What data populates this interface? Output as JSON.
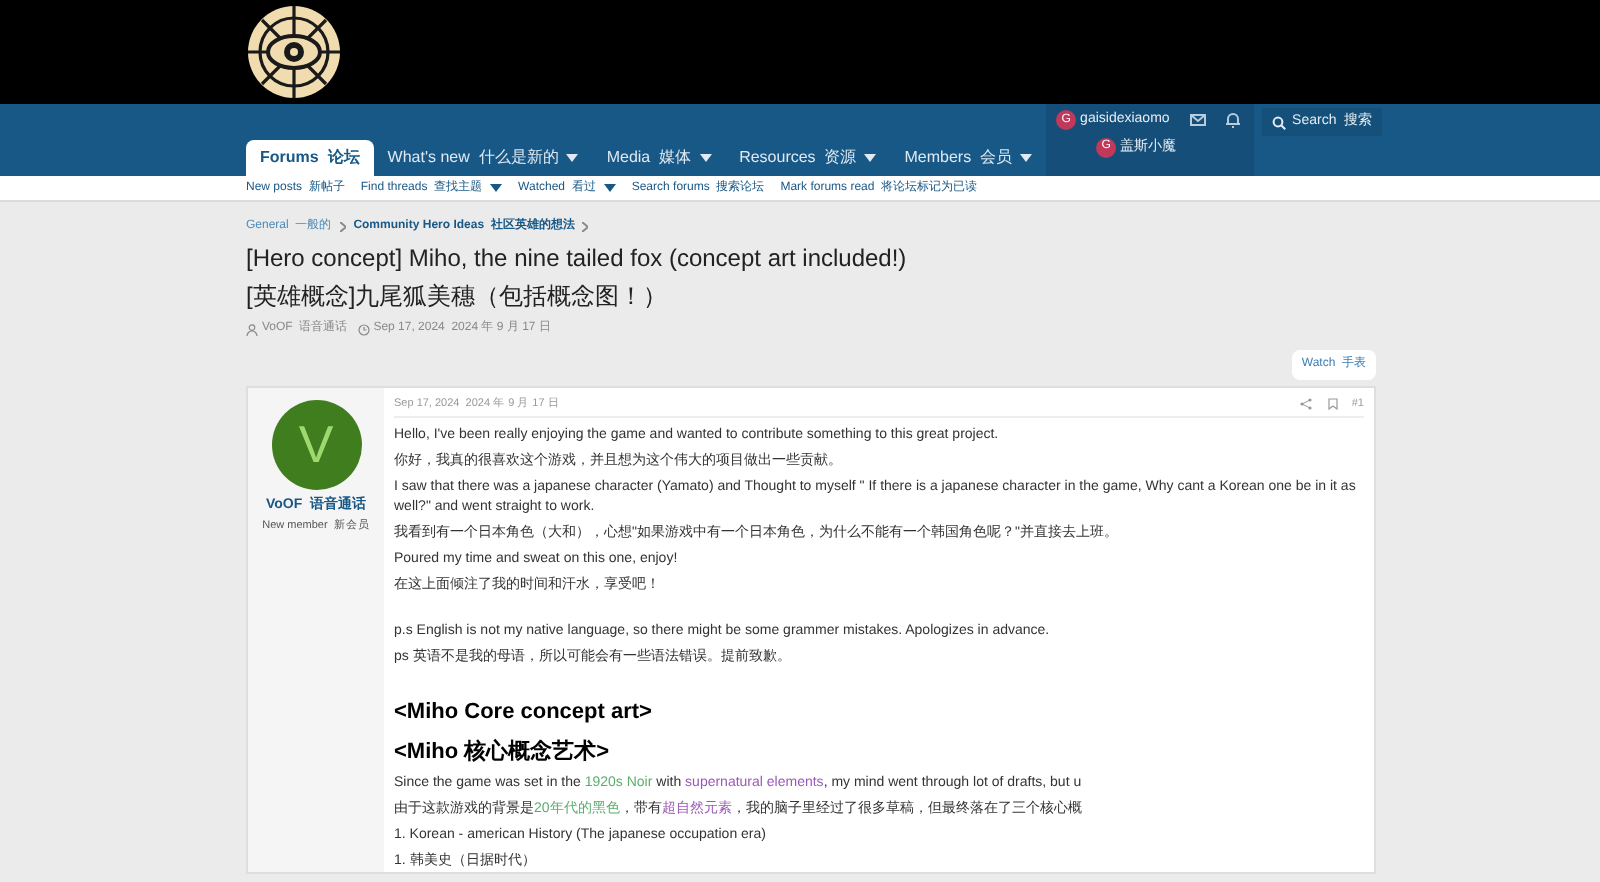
{
  "nav": {
    "tabs": [
      {
        "label": "Forums  论坛",
        "selected": true,
        "dropdown": false
      },
      {
        "label": "What's new  什么是新的",
        "selected": false,
        "dropdown": true
      },
      {
        "label": "Media  媒体",
        "selected": false,
        "dropdown": true
      },
      {
        "label": "Resources  资源",
        "selected": false,
        "dropdown": true
      },
      {
        "label": "Members  会员",
        "selected": false,
        "dropdown": true
      }
    ],
    "user": {
      "avatar_letter": "G",
      "name": "gaisidexiaomo",
      "alt_avatar_letter": "G",
      "alt_name": "盖斯小魔"
    },
    "search": "Search  搜索"
  },
  "subnav": [
    {
      "label": "New posts  新帖子",
      "dropdown": false
    },
    {
      "label": "Find threads  查找主题",
      "dropdown": true
    },
    {
      "label": "Watched  看过",
      "dropdown": true
    },
    {
      "label": "Search forums  搜索论坛",
      "dropdown": false
    },
    {
      "label": "Mark forums read  将论坛标记为已读",
      "dropdown": false
    }
  ],
  "breadcrumbs": [
    {
      "label": "General  一般的",
      "bold": false
    },
    {
      "label": "Community Hero Ideas  社区英雄的想法",
      "bold": true
    }
  ],
  "thread": {
    "title": "[Hero concept] Miho, the nine tailed fox (concept art included!)",
    "title_cn": "[英雄概念]九尾狐美穗（包括概念图！）",
    "author": "VoOF  语音通话",
    "date": "Sep 17, 2024  2024 年 9 月 17 日"
  },
  "watch": "Watch  手表",
  "post": {
    "avatar_letter": "V",
    "author": "VoOF  语音通话",
    "role": "New member  新会员",
    "date": "Sep 17, 2024  2024 年 9 月 17 日",
    "number": "#1",
    "blocks": [
      {
        "kind": "p",
        "parts": [
          {
            "text": "Hello, I've been really enjoying the game and wanted to contribute something to this great project."
          }
        ]
      },
      {
        "kind": "p",
        "parts": [
          {
            "text": "你好，我真的很喜欢这个游戏，并且想为这个伟大的项目做出一些贡献。"
          }
        ]
      },
      {
        "kind": "p",
        "parts": [
          {
            "text": "I saw that there was a japanese character (Yamato) and Thought to myself \" If there is a japanese character in the game, Why cant a Korean one be in it as well?\" and went straight to work."
          }
        ]
      },
      {
        "kind": "p",
        "parts": [
          {
            "text": "我看到有一个日本角色（大和），心想\"如果游戏中有一个日本角色，为什么不能有一个韩国角色呢？\"并直接去上班。"
          }
        ]
      },
      {
        "kind": "p",
        "parts": [
          {
            "text": "Poured my time and sweat on this one, enjoy!"
          }
        ]
      },
      {
        "kind": "p",
        "parts": [
          {
            "text": "在这上面倾注了我的时间和汗水，享受吧！"
          }
        ]
      },
      {
        "kind": "gap"
      },
      {
        "kind": "p",
        "parts": [
          {
            "text": "p.s English is not my native language, so there might be some grammer mistakes. Apologizes in advance."
          }
        ]
      },
      {
        "kind": "p",
        "parts": [
          {
            "text": "ps 英语不是我的母语，所以可能会有一些语法错误。提前致歉。"
          }
        ]
      },
      {
        "kind": "gap"
      },
      {
        "kind": "heading",
        "parts": [
          {
            "text": "<Miho Core concept art>"
          }
        ]
      },
      {
        "kind": "heading",
        "parts": [
          {
            "text": "<Miho 核心概念艺术>"
          }
        ]
      },
      {
        "kind": "p",
        "parts": [
          {
            "text": "Since the game was set in the "
          },
          {
            "text": "1920s Noir",
            "color": "#5aae6c"
          },
          {
            "text": " with "
          },
          {
            "text": "supernatural elements",
            "color": "#9b59b6"
          },
          {
            "text": ", my mind went through lot of drafts, but u"
          }
        ]
      },
      {
        "kind": "p",
        "parts": [
          {
            "text": "由于这款游戏的背景是"
          },
          {
            "text": "20年代的黑色",
            "color": "#5aae6c"
          },
          {
            "text": "，带有"
          },
          {
            "text": "超自然元素",
            "color": "#9b59b6"
          },
          {
            "text": "，我的脑子里经过了很多草稿，但最终落在了三个核心概"
          }
        ]
      },
      {
        "kind": "p",
        "parts": [
          {
            "text": "1. Korean - american History (The japanese occupation era)"
          }
        ]
      },
      {
        "kind": "p",
        "parts": [
          {
            "text": "1. 韩美史（日据时代）"
          }
        ]
      }
    ]
  }
}
